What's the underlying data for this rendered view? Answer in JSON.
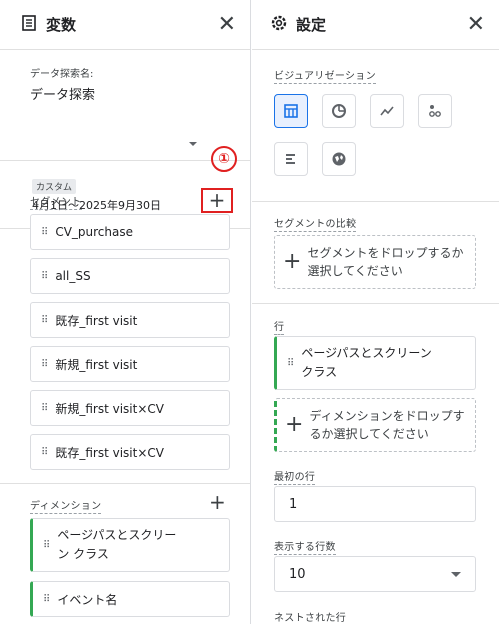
{
  "variables": {
    "title": "変数",
    "close": "✕",
    "data_name_label": "データ探索名:",
    "data_name_value": "データ探索",
    "date_chip": "カスタム",
    "date_range": "4月1日～2025年9月30日",
    "annotation": "①",
    "segments_label": "セグメント",
    "add": "+",
    "segments": [
      "CV_purchase",
      "all_SS",
      "既存_first visit",
      "新規_first visit",
      "新規_first visit×CV",
      "既存_first visit×CV"
    ],
    "dimensions_label": "ディメンション",
    "dimensions": [
      "ページパスとスクリーン クラス",
      "イベント名"
    ]
  },
  "settings": {
    "title": "設定",
    "close": "✕",
    "visualization_label": "ビジュアリゼーション",
    "viz_icons": [
      "table-icon",
      "donut-icon",
      "line-chart-icon",
      "scatter-icon",
      "bar-icon",
      "globe-icon"
    ],
    "segment_compare_label": "セグメントの比較",
    "segment_drop": "セグメントをドロップするか選択してください",
    "rows_label": "行",
    "row_item": "ページパスとスクリーン クラス",
    "dim_drop": "ディメンションをドロップするか選択してください",
    "first_row_label": "最初の行",
    "first_row_value": "1",
    "show_rows_label": "表示する行数",
    "show_rows_value": "10",
    "nested_rows_label": "ネストされた行"
  },
  "colors": {
    "accent": "#1a73e8",
    "green": "#34a853",
    "annotation_red": "#e02020"
  }
}
